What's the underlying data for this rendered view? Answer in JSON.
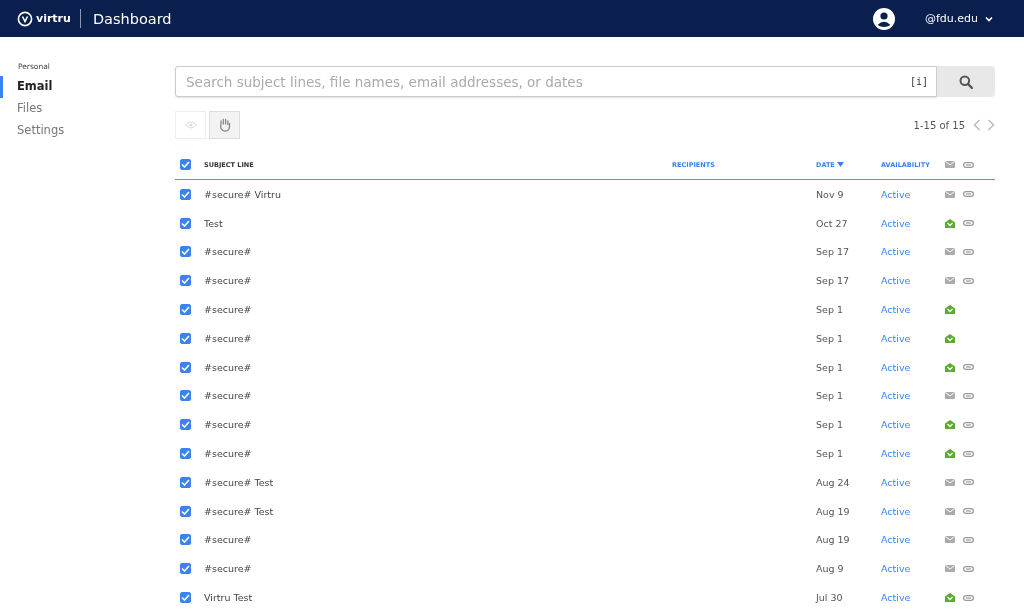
{
  "header": {
    "logo": "virtru",
    "title": "Dashboard",
    "account": "@fdu.edu"
  },
  "sidebar": {
    "section": "Personal",
    "items": [
      {
        "label": "Email",
        "selected": true
      },
      {
        "label": "Files",
        "selected": false
      },
      {
        "label": "Settings",
        "selected": false
      }
    ]
  },
  "search": {
    "placeholder": "Search subject lines, file names, email addresses, or dates",
    "help": "[i]"
  },
  "pagination": "1-15 of 15",
  "table": {
    "all_checked": true,
    "columns": [
      "SUBJECT LINE",
      "RECIPIENTS",
      "DATE",
      "AVAILABILITY"
    ],
    "rows": [
      {
        "checked": true,
        "subject": "#secure# Virtru",
        "date": "Nov 9",
        "availability": "Active",
        "opened": false,
        "attachment": true
      },
      {
        "checked": true,
        "subject": "Test",
        "date": "Oct 27",
        "availability": "Active",
        "opened": true,
        "attachment": true
      },
      {
        "checked": true,
        "subject": "#secure#",
        "date": "Sep 17",
        "availability": "Active",
        "opened": false,
        "attachment": true
      },
      {
        "checked": true,
        "subject": "#secure#",
        "date": "Sep 17",
        "availability": "Active",
        "opened": false,
        "attachment": true
      },
      {
        "checked": true,
        "subject": "#secure#",
        "date": "Sep 1",
        "availability": "Active",
        "opened": true,
        "attachment": false
      },
      {
        "checked": true,
        "subject": "#secure#",
        "date": "Sep 1",
        "availability": "Active",
        "opened": true,
        "attachment": false
      },
      {
        "checked": true,
        "subject": "#secure#",
        "date": "Sep 1",
        "availability": "Active",
        "opened": true,
        "attachment": true
      },
      {
        "checked": true,
        "subject": "#secure#",
        "date": "Sep 1",
        "availability": "Active",
        "opened": false,
        "attachment": true
      },
      {
        "checked": true,
        "subject": "#secure#",
        "date": "Sep 1",
        "availability": "Active",
        "opened": true,
        "attachment": true
      },
      {
        "checked": true,
        "subject": "#secure#",
        "date": "Sep 1",
        "availability": "Active",
        "opened": true,
        "attachment": true
      },
      {
        "checked": true,
        "subject": "#secure# Test",
        "date": "Aug 24",
        "availability": "Active",
        "opened": false,
        "attachment": true
      },
      {
        "checked": true,
        "subject": "#secure# Test",
        "date": "Aug 19",
        "availability": "Active",
        "opened": false,
        "attachment": true
      },
      {
        "checked": true,
        "subject": "#secure#",
        "date": "Aug 19",
        "availability": "Active",
        "opened": false,
        "attachment": true
      },
      {
        "checked": true,
        "subject": "#secure#",
        "date": "Aug 9",
        "availability": "Active",
        "opened": false,
        "attachment": true
      },
      {
        "checked": true,
        "subject": "Virtru Test",
        "date": "Jul 30",
        "availability": "Active",
        "opened": true,
        "attachment": true
      }
    ]
  }
}
